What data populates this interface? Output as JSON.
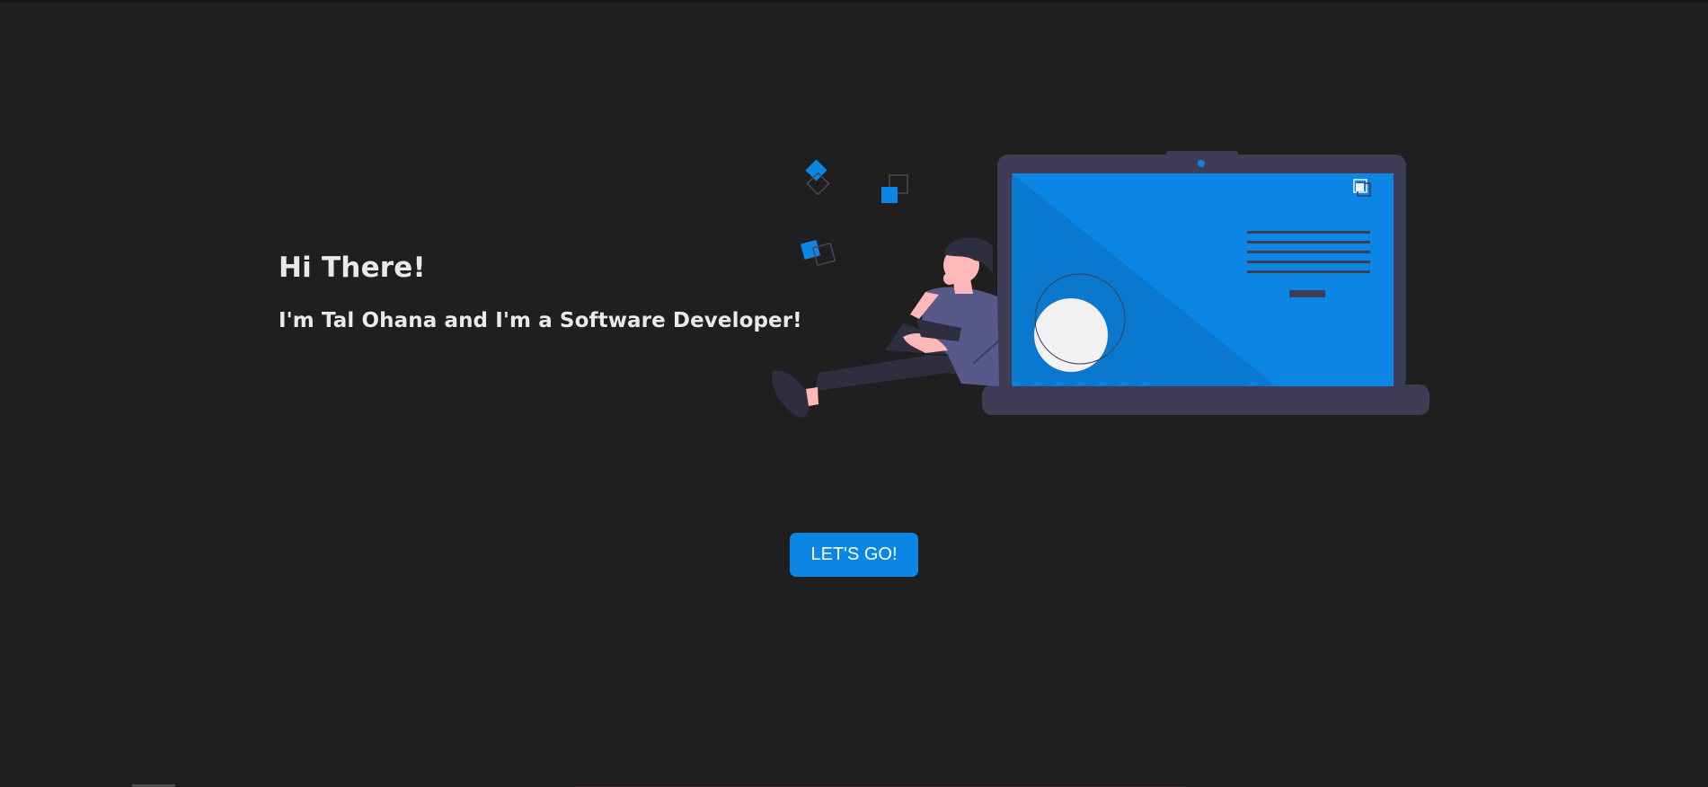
{
  "hero": {
    "title": "Hi There!",
    "subtitle": "I'm Tal Ohana and I'm a Software Developer!"
  },
  "cta": {
    "label": "LET'S GO!"
  },
  "theme": {
    "background": "#1f1f1f",
    "accent": "#0b86e5",
    "text": "#e9e9e9",
    "laptop_frame": "#3f3d56"
  },
  "illustration": {
    "icon": "developer-with-laptop-illustration"
  }
}
